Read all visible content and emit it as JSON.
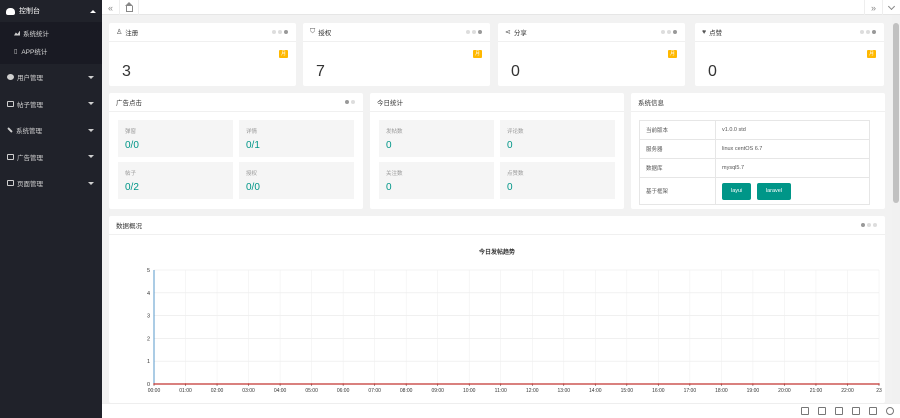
{
  "sidebar": {
    "top": {
      "label": "控制台"
    },
    "sub_items": [
      {
        "label": "系统统计",
        "icon": "bar-chart-icon"
      },
      {
        "label": "APP统计",
        "icon": "phone-icon"
      }
    ],
    "nav": [
      {
        "label": "用户管理",
        "icon": "users-icon"
      },
      {
        "label": "帖子管理",
        "icon": "post-icon"
      },
      {
        "label": "系统管理",
        "icon": "wrench-icon"
      },
      {
        "label": "广告管理",
        "icon": "ad-icon"
      },
      {
        "label": "页面管理",
        "icon": "page-icon"
      }
    ]
  },
  "stats": [
    {
      "title": "注册",
      "icon": "user-icon",
      "badge": "月",
      "value": "3"
    },
    {
      "title": "授权",
      "icon": "shield-icon",
      "badge": "月",
      "value": "7"
    },
    {
      "title": "分享",
      "icon": "share-icon",
      "badge": "月",
      "value": "0"
    },
    {
      "title": "点赞",
      "icon": "heart-icon",
      "badge": "月",
      "value": "0"
    }
  ],
  "ads": {
    "title": "广告点击",
    "items": [
      {
        "label": "弹窗",
        "value": "0/0"
      },
      {
        "label": "详情",
        "value": "0/1"
      },
      {
        "label": "帖子",
        "value": "0/2"
      },
      {
        "label": "授权",
        "value": "0/0"
      }
    ]
  },
  "today": {
    "title": "今日统计",
    "items": [
      {
        "label": "发帖数",
        "value": "0"
      },
      {
        "label": "评论数",
        "value": "0"
      },
      {
        "label": "关注数",
        "value": "0"
      },
      {
        "label": "点赞数",
        "value": "0"
      }
    ]
  },
  "sysinfo": {
    "title": "系统信息",
    "rows": [
      {
        "key": "当前版本",
        "value": "v1.0.0 std"
      },
      {
        "key": "服务器",
        "value": "linux centOS 6.7"
      },
      {
        "key": "数据库",
        "value": "mysql5.7"
      }
    ],
    "framework_key": "基于框架",
    "frameworks": [
      "layui",
      "laravel"
    ]
  },
  "overview": {
    "title": "数据概况"
  },
  "chart_data": {
    "type": "line",
    "title": "今日发帖趋势",
    "x": [
      "00:00",
      "01:00",
      "02:00",
      "03:00",
      "04:00",
      "05:00",
      "06:00",
      "07:00",
      "08:00",
      "09:00",
      "10:00",
      "11:00",
      "12:00",
      "13:00",
      "14:00",
      "15:00",
      "16:00",
      "17:00",
      "18:00",
      "19:00",
      "20:00",
      "21:00",
      "22:00",
      "23"
    ],
    "series": [
      {
        "values": [
          0,
          0,
          0,
          0,
          0,
          0,
          0,
          0,
          0,
          0,
          0,
          0,
          0,
          0,
          0,
          0,
          0,
          0,
          0,
          0,
          0,
          0,
          0,
          0
        ],
        "color": "#c23531"
      }
    ],
    "yticks": [
      "0",
      "1",
      "2",
      "3",
      "4",
      "5"
    ],
    "ylim": [
      0,
      5
    ],
    "grid": true
  },
  "colors": {
    "accent": "#009688",
    "badge": "#ffb800",
    "sidebar": "#20222a"
  }
}
